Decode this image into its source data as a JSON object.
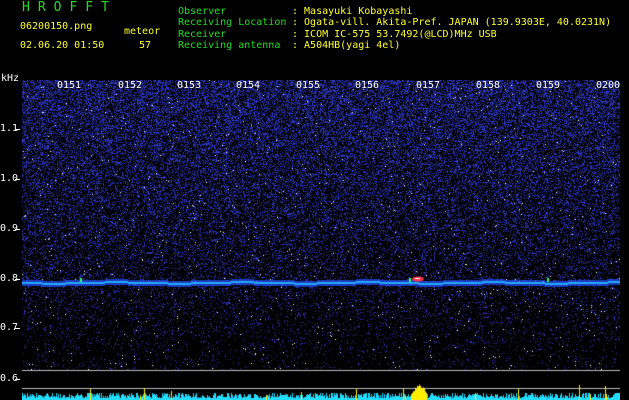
{
  "header": {
    "title": "HROFFT",
    "filename": "06200150.png",
    "datetime": "02.06.20 01:50",
    "count_label": "meteor",
    "count_value": "57"
  },
  "info": [
    {
      "label": "Observer",
      "value": ": Masayuki Kobayashi"
    },
    {
      "label": "Receiving Location",
      "value": ": Ogata-vill. Akita-Pref. JAPAN (139.9303E, 40.0231N)"
    },
    {
      "label": "Receiver",
      "value": ": ICOM IC-575 53.7492(@LCD)MHz USB"
    },
    {
      "label": "Receiving antenna",
      "value": ": A504HB(yagi 4el)"
    }
  ],
  "axis": {
    "unit": "kHz",
    "y_ticks": [
      "1.1",
      "1.0",
      "0.9",
      "0.8",
      "0.7",
      "0.6"
    ],
    "x_ticks": [
      "0151",
      "0152",
      "0153",
      "0154",
      "0155",
      "0156",
      "0157",
      "0158",
      "0159",
      "0200"
    ]
  },
  "colors": {
    "label_green": "#22dd22",
    "value_yellow": "#ffff33",
    "noise_blue": "#3344ff",
    "carrier_cyan": "#22aaff",
    "meteor_red": "#ff3344",
    "power_yellow": "#ffee00",
    "power_cyan": "#22ddff"
  }
}
